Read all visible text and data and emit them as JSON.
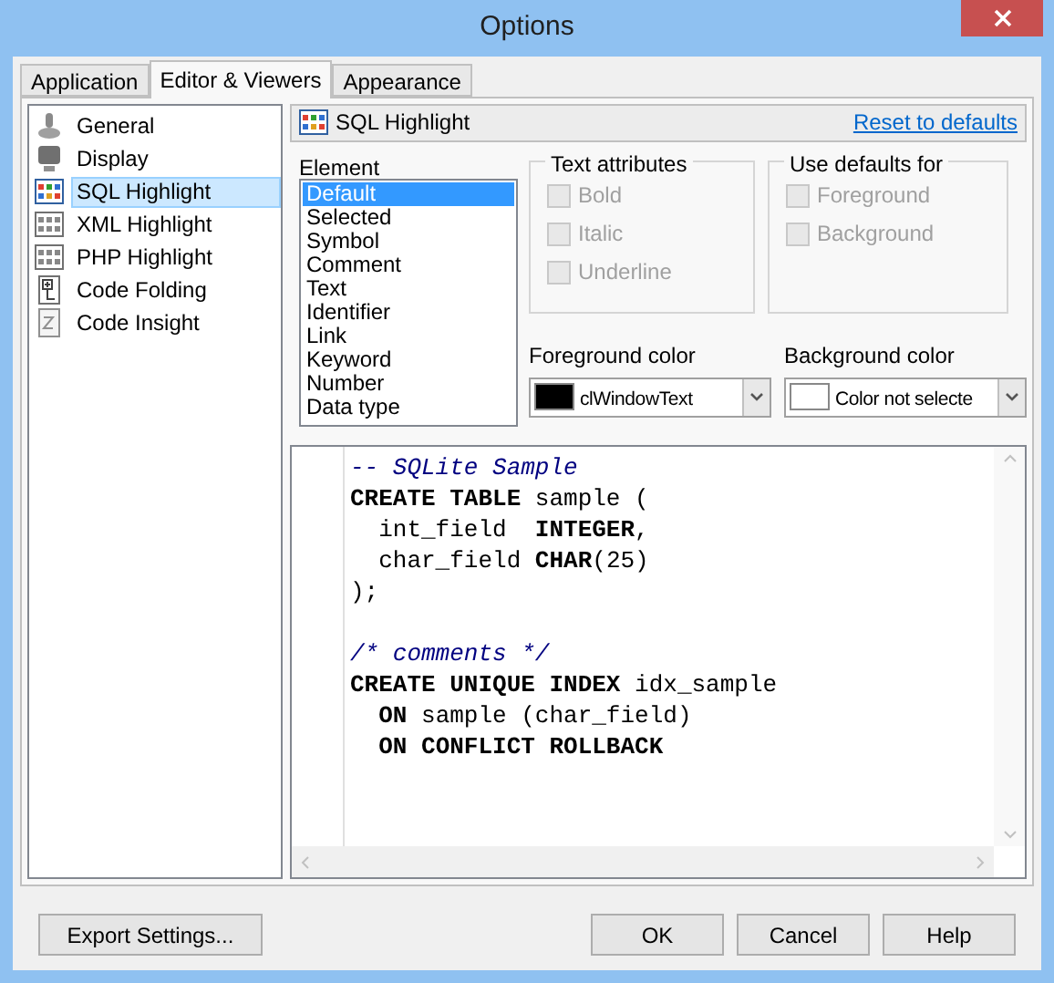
{
  "window": {
    "title": "Options"
  },
  "tabs": [
    {
      "label": "Application",
      "selected": false
    },
    {
      "label": "Editor & Viewers",
      "selected": true
    },
    {
      "label": "Appearance",
      "selected": false
    }
  ],
  "sidebar": {
    "items": [
      {
        "label": "General",
        "kind": "general",
        "selected": false
      },
      {
        "label": "Display",
        "kind": "display",
        "selected": false
      },
      {
        "label": "SQL Highlight",
        "kind": "grid-color",
        "selected": true
      },
      {
        "label": "XML Highlight",
        "kind": "grid",
        "selected": false
      },
      {
        "label": "PHP Highlight",
        "kind": "grid",
        "selected": false
      },
      {
        "label": "Code Folding",
        "kind": "folding",
        "selected": false
      },
      {
        "label": "Code Insight",
        "kind": "insight",
        "selected": false
      }
    ]
  },
  "panel": {
    "title": "SQL Highlight",
    "reset_link": "Reset to defaults"
  },
  "element": {
    "label": "Element",
    "items": [
      {
        "label": "Default",
        "selected": true
      },
      {
        "label": "Selected",
        "selected": false
      },
      {
        "label": "Symbol",
        "selected": false
      },
      {
        "label": "Comment",
        "selected": false
      },
      {
        "label": "Text",
        "selected": false
      },
      {
        "label": "Identifier",
        "selected": false
      },
      {
        "label": "Link",
        "selected": false
      },
      {
        "label": "Keyword",
        "selected": false
      },
      {
        "label": "Number",
        "selected": false
      },
      {
        "label": "Data type",
        "selected": false
      }
    ]
  },
  "text_attributes": {
    "title": "Text attributes",
    "options": [
      {
        "label": "Bold",
        "checked": false,
        "disabled": true
      },
      {
        "label": "Italic",
        "checked": false,
        "disabled": true
      },
      {
        "label": "Underline",
        "checked": false,
        "disabled": true
      }
    ]
  },
  "use_defaults_for": {
    "title": "Use defaults for",
    "options": [
      {
        "label": "Foreground",
        "checked": false,
        "disabled": true
      },
      {
        "label": "Background",
        "checked": false,
        "disabled": true
      }
    ]
  },
  "foreground_color": {
    "label": "Foreground color",
    "value": "clWindowText",
    "color": "#000000"
  },
  "background_color": {
    "label": "Background color",
    "value": "Color not selecte",
    "color": "#ffffff"
  },
  "code": [
    {
      "kind": "comment",
      "text": "-- SQLite Sample"
    },
    {
      "kind": "code",
      "text": "**CREATE TABLE** sample ("
    },
    {
      "kind": "code",
      "text": "  int_field  **INTEGER**,"
    },
    {
      "kind": "code",
      "text": "  char_field **CHAR**(25)"
    },
    {
      "kind": "code",
      "text": ");"
    },
    {
      "kind": "blank"
    },
    {
      "kind": "comment",
      "text": "/* comments */"
    },
    {
      "kind": "code",
      "text": "**CREATE UNIQUE INDEX** idx_sample"
    },
    {
      "kind": "code",
      "text": "  **ON** sample (char_field)"
    },
    {
      "kind": "code",
      "text": "  **ON CONFLICT ROLLBACK**"
    }
  ],
  "buttons": {
    "export": "Export Settings...",
    "ok": "OK",
    "cancel": "Cancel",
    "help": "Help"
  }
}
